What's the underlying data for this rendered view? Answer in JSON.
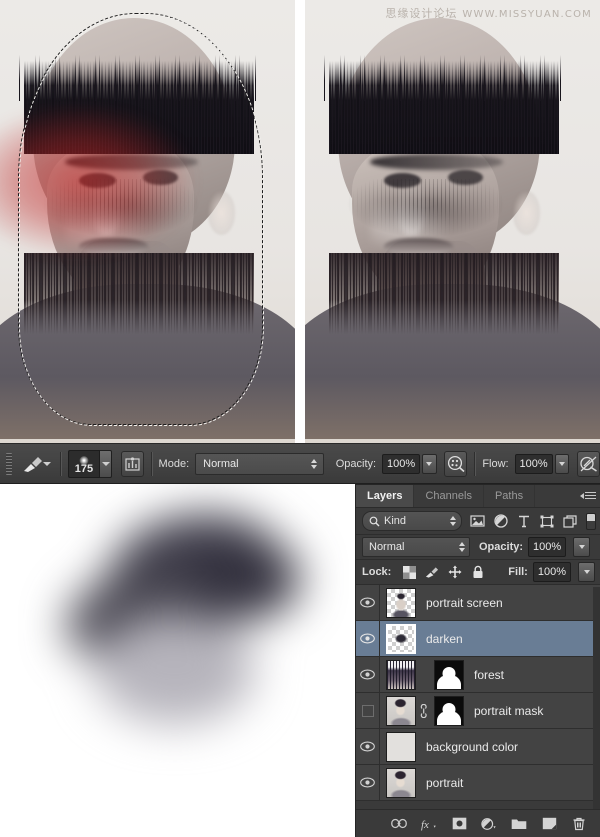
{
  "watermark": {
    "chinese": "思缘设计论坛",
    "url": "WWW.MISSYUAN.COM"
  },
  "options_bar": {
    "brush_preview_name": "brush-tool",
    "brush_size": "175",
    "tablet_pressure_icon": "tablet-pressure-icon",
    "mode_label": "Mode:",
    "mode_value": "Normal",
    "opacity_label": "Opacity:",
    "opacity_value": "100%",
    "airbrush_icon": "airbrush-icon",
    "flow_label": "Flow:",
    "flow_value": "100%",
    "smoothing_icon": "flow-pressure-icon"
  },
  "layers_panel": {
    "tabs": [
      {
        "label": "Layers",
        "active": true
      },
      {
        "label": "Channels",
        "active": false
      },
      {
        "label": "Paths",
        "active": false
      }
    ],
    "menu_icon": "panel-menu-icon",
    "filter": {
      "search_icon": "search-icon",
      "kind_value": "Kind",
      "icons": [
        "pixel-layer-filter-icon",
        "adjustment-filter-icon",
        "type-filter-icon",
        "shape-filter-icon",
        "smart-object-filter-icon"
      ],
      "toggle_icon": "filter-toggle-icon"
    },
    "blend": {
      "mode_value": "Normal",
      "opacity_label": "Opacity:",
      "opacity_value": "100%"
    },
    "lock": {
      "label": "Lock:",
      "icons": [
        "lock-transparency-icon",
        "lock-image-icon",
        "lock-position-icon",
        "lock-all-icon"
      ],
      "fill_label": "Fill:",
      "fill_value": "100%"
    },
    "layers": [
      {
        "name": "portrait screen",
        "visible": true,
        "selected": false,
        "thumb": "checker-face",
        "mask": false,
        "linked": false
      },
      {
        "name": "darken",
        "visible": true,
        "selected": true,
        "thumb": "checker-blob",
        "mask": false,
        "linked": false
      },
      {
        "name": "forest",
        "visible": true,
        "selected": false,
        "thumb": "forest",
        "mask": true,
        "linked": false
      },
      {
        "name": "portrait mask",
        "visible": false,
        "selected": false,
        "thumb": "portrait",
        "mask": true,
        "linked": true
      },
      {
        "name": "background color",
        "visible": true,
        "selected": false,
        "thumb": "flat",
        "mask": false,
        "linked": false
      },
      {
        "name": "portrait",
        "visible": true,
        "selected": false,
        "thumb": "portrait",
        "mask": false,
        "linked": false
      }
    ],
    "footer_buttons": [
      "link-layers-icon",
      "layer-style-fx-icon",
      "add-mask-icon",
      "adjustment-layer-icon",
      "new-group-icon",
      "new-layer-icon",
      "delete-layer-icon"
    ]
  },
  "colors": {
    "panel_bg": "#3a3a3a",
    "row_bg": "#434343",
    "selected_row": "#697d95",
    "text": "#eaeaea",
    "red_overlay": "#c42424"
  }
}
